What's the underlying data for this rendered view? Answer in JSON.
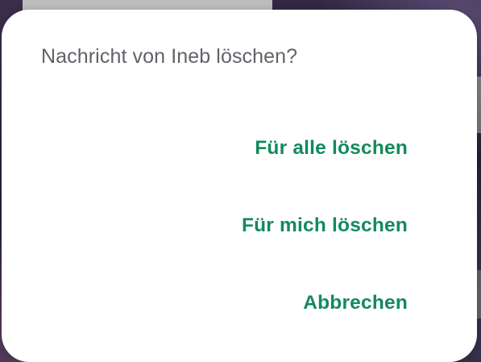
{
  "dialog": {
    "title": "Nachricht von Ineb löschen?",
    "actions": {
      "delete_for_all": "Für alle löschen",
      "delete_for_me": "Für mich löschen",
      "cancel": "Abbrechen"
    }
  },
  "colors": {
    "accent": "#138a5c",
    "title_text": "#5f6368",
    "dialog_background": "#ffffff"
  }
}
